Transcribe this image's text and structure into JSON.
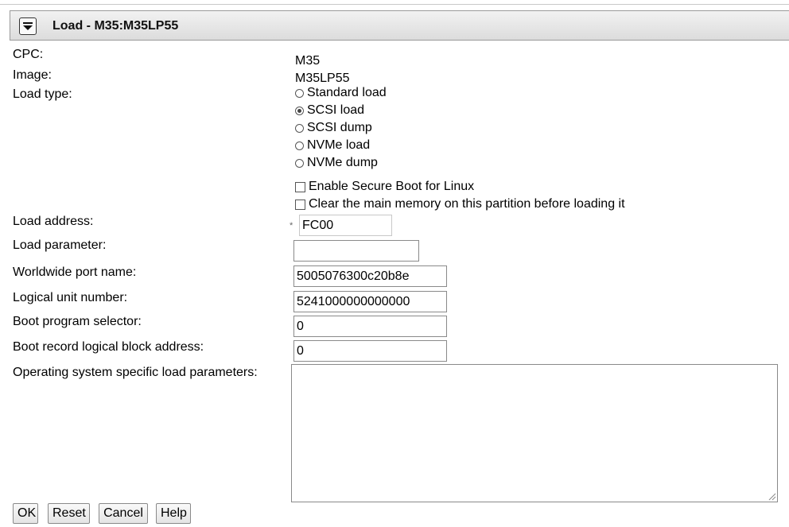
{
  "window": {
    "title": "Load - M35:M35LP55",
    "menu_icon": "menu-dropdown-icon"
  },
  "fields": {
    "cpc": {
      "label": "CPC:",
      "value": "M35"
    },
    "image": {
      "label": "Image:",
      "value": "M35LP55"
    },
    "load_type": {
      "label": "Load type:",
      "options": [
        {
          "label": "Standard load",
          "checked": false
        },
        {
          "label": "SCSI load",
          "checked": true
        },
        {
          "label": "SCSI dump",
          "checked": false
        },
        {
          "label": "NVMe load",
          "checked": false
        },
        {
          "label": "NVMe dump",
          "checked": false
        }
      ]
    },
    "checkboxes": [
      {
        "label": "Enable Secure Boot for Linux",
        "checked": false
      },
      {
        "label": "Clear the main memory on this partition before loading it",
        "checked": false
      }
    ],
    "load_address": {
      "label": "Load address:",
      "value": "FC00",
      "required_marker": "*"
    },
    "load_parameter": {
      "label": "Load parameter:",
      "value": ""
    },
    "wwpn": {
      "label": "Worldwide port name:",
      "value": "5005076300c20b8e"
    },
    "lun": {
      "label": "Logical unit number:",
      "value": "5241000000000000"
    },
    "boot_program_selector": {
      "label": "Boot program selector:",
      "value": "0"
    },
    "boot_record_lba": {
      "label": "Boot record logical block address:",
      "value": "0"
    },
    "os_load_parameters": {
      "label": "Operating system specific load parameters:",
      "value": ""
    }
  },
  "buttons": {
    "ok": "OK",
    "reset": "Reset",
    "cancel": "Cancel",
    "help": "Help"
  }
}
